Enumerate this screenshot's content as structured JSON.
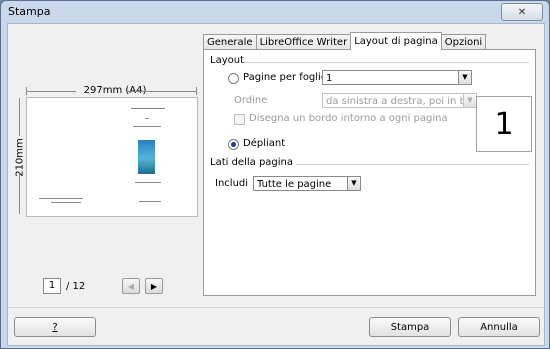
{
  "window": {
    "title": "Stampa",
    "close_icon": "close-icon"
  },
  "preview": {
    "width_label": "297mm (A4)",
    "height_label": "210mm",
    "page_current": "1",
    "page_total": "/ 12"
  },
  "tabs": [
    {
      "label": "Generale",
      "active": false
    },
    {
      "label": "LibreOffice Writer",
      "active": false
    },
    {
      "label": "Layout di pagina",
      "active": true
    },
    {
      "label": "Opzioni",
      "active": false
    }
  ],
  "layout": {
    "section_title": "Layout",
    "pages_per_sheet_label": "Pagine per foglio",
    "pages_per_sheet_value": "1",
    "order_label": "Ordine",
    "order_value": "da sinistra a destra, poi in basso",
    "border_label": "Disegna un bordo intorno a ogni pagina",
    "brochure_label": "Dépliant",
    "preview_number": "1"
  },
  "sides": {
    "section_title": "Lati della pagina",
    "include_label": "Includi",
    "include_value": "Tutte le pagine"
  },
  "buttons": {
    "help": "?",
    "print": "Stampa",
    "cancel": "Annulla"
  }
}
